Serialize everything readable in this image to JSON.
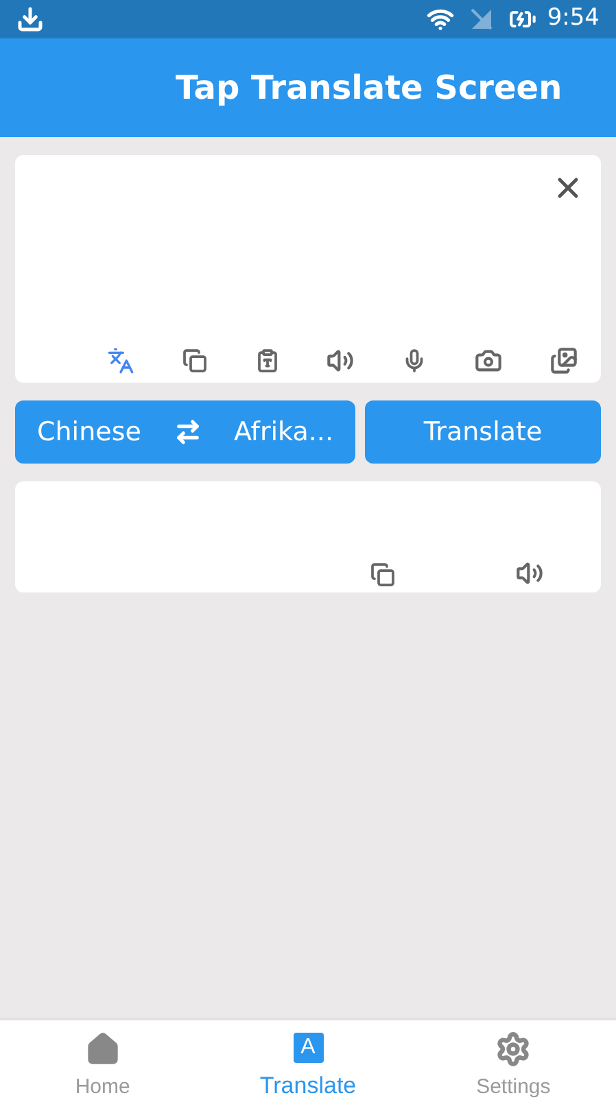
{
  "status_bar": {
    "time": "9:54"
  },
  "app_bar": {
    "title": "Tap Translate Screen"
  },
  "language_bar": {
    "source": "Chinese",
    "target": "Afrika...",
    "translate_button": "Translate"
  },
  "bottom_nav": [
    {
      "label": "Home",
      "kind": "home",
      "selected": false
    },
    {
      "label": "Translate",
      "kind": "translate",
      "icon_text": "A",
      "selected": true
    },
    {
      "label": "Settings",
      "kind": "settings",
      "selected": false
    }
  ]
}
